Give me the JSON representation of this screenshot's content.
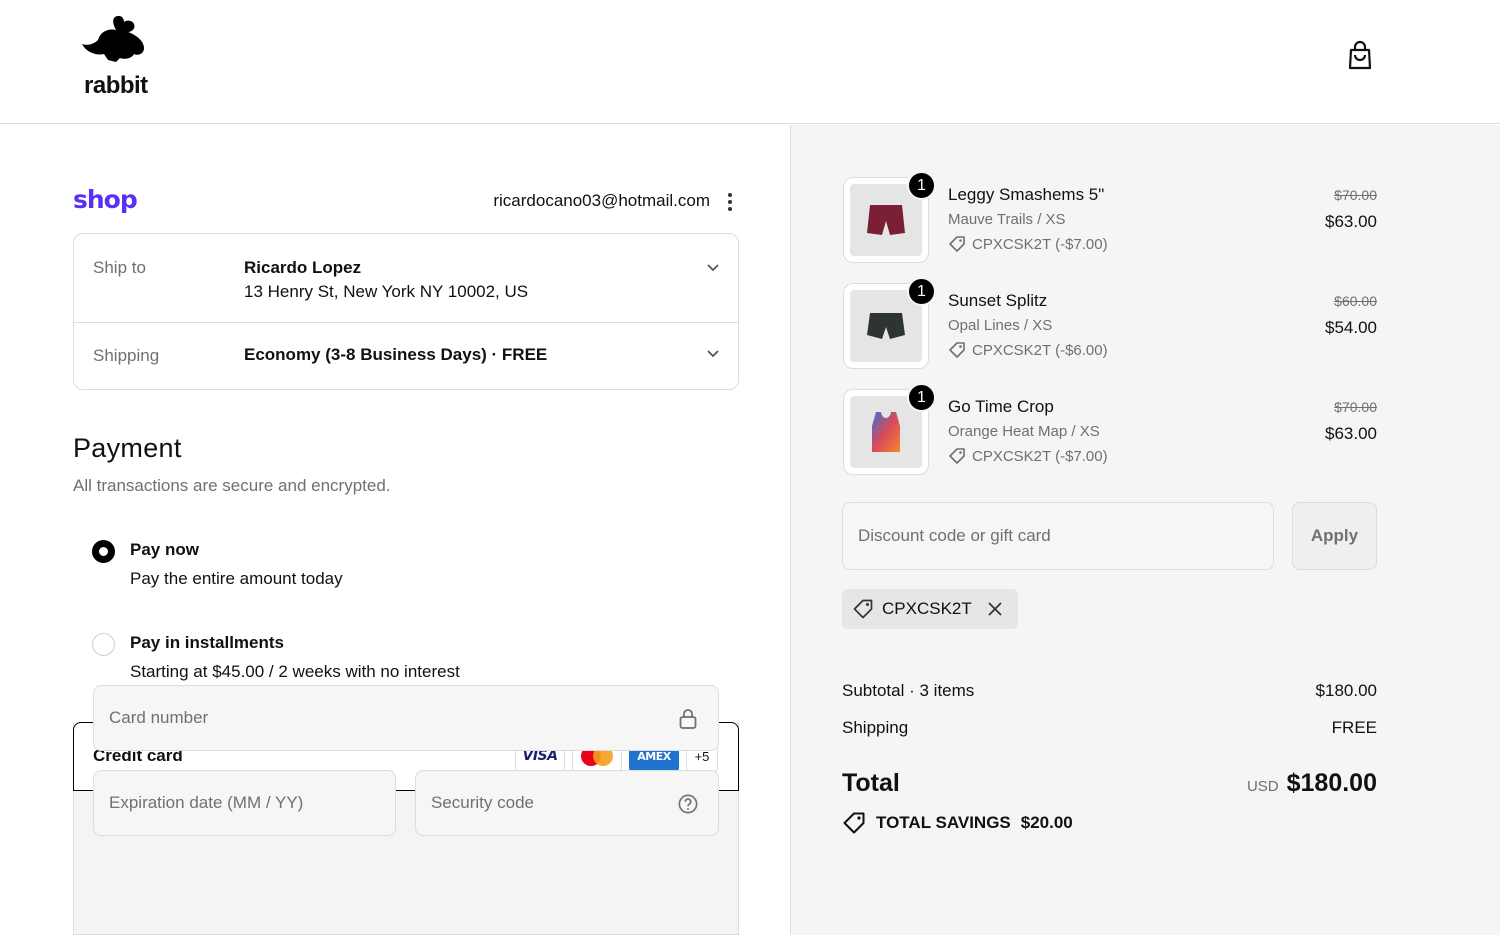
{
  "header": {
    "logo_text": "rabbit",
    "cart_icon": "shopping-bag-icon"
  },
  "account": {
    "shop_brand": "shop",
    "email": "ricardocano03@hotmail.com"
  },
  "ship_to": {
    "label": "Ship to",
    "name": "Ricardo Lopez",
    "address": "13 Henry St, New York NY 10002, US"
  },
  "shipping_method": {
    "label": "Shipping",
    "value": "Economy (3-8 Business Days) · FREE"
  },
  "payment": {
    "title": "Payment",
    "subtitle": "All transactions are secure and encrypted.",
    "options": [
      {
        "title": "Pay now",
        "desc": "Pay the entire amount today",
        "selected": true
      },
      {
        "title": "Pay in installments",
        "desc": "Starting at $45.00 / 2 weeks with no interest",
        "selected": false
      }
    ],
    "credit_card": {
      "title": "Credit card",
      "brands": [
        "VISA",
        "mastercard",
        "AMEX"
      ],
      "more": "+5",
      "card_number_placeholder": "Card number",
      "expiration_placeholder": "Expiration date (MM / YY)",
      "security_placeholder": "Security code"
    }
  },
  "cart": {
    "items": [
      {
        "qty": "1",
        "name": "Leggy Smashems 5\"",
        "variant": "Mauve Trails / XS",
        "discount": "CPXCSK2T (-$7.00)",
        "old_price": "$70.00",
        "price": "$63.00",
        "color": "#7a1f35"
      },
      {
        "qty": "1",
        "name": "Sunset Splitz",
        "variant": "Opal Lines / XS",
        "discount": "CPXCSK2T (-$6.00)",
        "old_price": "$60.00",
        "price": "$54.00",
        "color": "#2e3431"
      },
      {
        "qty": "1",
        "name": "Go Time Crop",
        "variant": "Orange Heat Map / XS",
        "discount": "CPXCSK2T (-$7.00)",
        "old_price": "$70.00",
        "price": "$63.00",
        "color": "#c0395a"
      }
    ],
    "discount_placeholder": "Discount code or gift card",
    "apply_label": "Apply",
    "applied_code": "CPXCSK2T",
    "subtotal_label": "Subtotal · 3 items",
    "subtotal_value": "$180.00",
    "shipping_label": "Shipping",
    "shipping_value": "FREE",
    "total_label": "Total",
    "total_currency": "USD",
    "total_value": "$180.00",
    "savings_label": "TOTAL SAVINGS",
    "savings_value": "$20.00"
  }
}
